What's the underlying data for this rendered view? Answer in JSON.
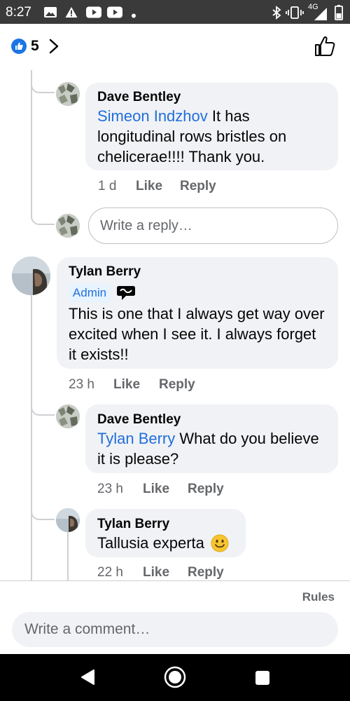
{
  "status_bar": {
    "time": "8:27",
    "network": "4G",
    "icons": [
      "gallery-icon",
      "warning-icon",
      "youtube-icon",
      "youtube-icon",
      "dot-icon",
      "bluetooth-icon",
      "vibrate-icon",
      "signal-icon",
      "battery-icon"
    ]
  },
  "reactions": {
    "count": "5",
    "icon": "like-badge-icon"
  },
  "comments": [
    {
      "author": "Dave Bentley",
      "mention": "Simeon Indzhov",
      "line1_rest": " It has",
      "line2": "longitudinal rows bristles on",
      "line3": "chelicerae!!!! Thank you.",
      "time": "1 d",
      "like_label": "Like",
      "reply_label": "Reply"
    },
    {
      "author": "Tylan Berry",
      "badge": "Admin",
      "line1": "This is one that I always get way over",
      "line2": "excited when I see it. I always forget",
      "line3": "it exists!!",
      "time": "23 h",
      "like_label": "Like",
      "reply_label": "Reply"
    },
    {
      "author": "Dave Bentley",
      "mention": "Tylan Berry",
      "line1_rest": " What do you believe",
      "line2": "it is please?",
      "time": "23 h",
      "like_label": "Like",
      "reply_label": "Reply"
    },
    {
      "author": "Tylan Berry",
      "text": "Tallusia experta",
      "emoji": "🙂",
      "time": "22 h",
      "like_label": "Like",
      "reply_label": "Reply"
    }
  ],
  "reply_box": {
    "placeholder": "Write a reply…"
  },
  "footer": {
    "rules_label": "Rules",
    "comment_placeholder": "Write a comment…"
  },
  "colors": {
    "accent": "#1b74e4",
    "mention": "#216fdb",
    "bubble": "#f0f2f5",
    "meta": "#65676b"
  }
}
